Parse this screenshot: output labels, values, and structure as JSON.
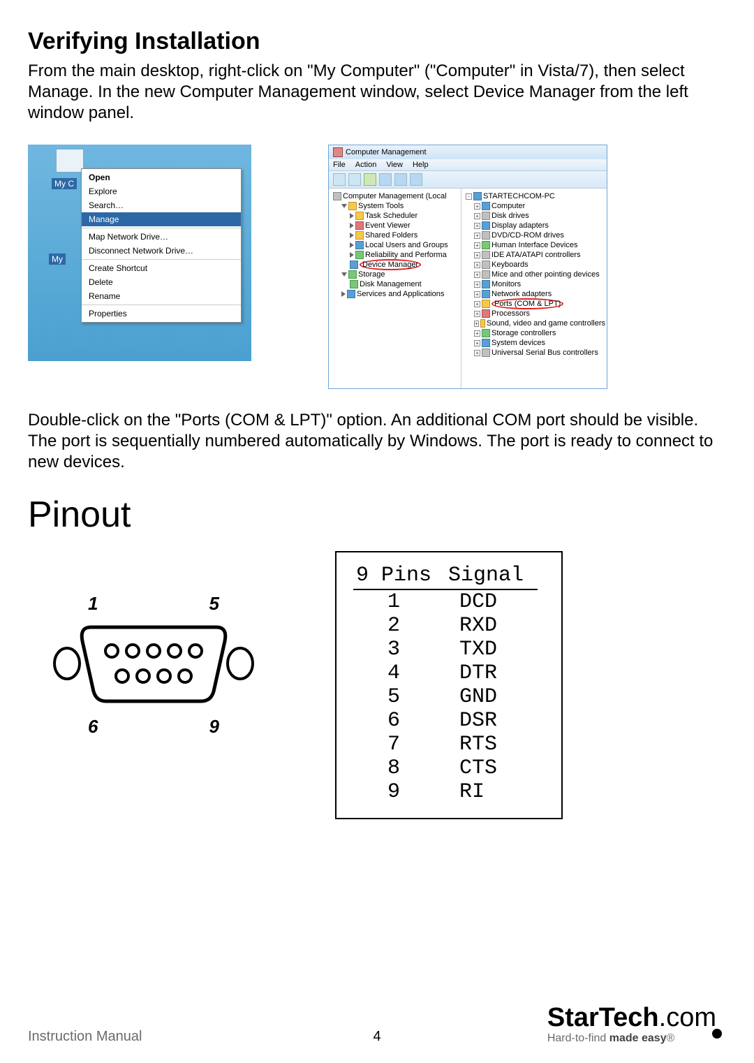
{
  "section1": {
    "title": "Verifying Installation",
    "para1": "From the main desktop, right-click on \"My Computer\" (\"Computer\" in Vista/7), then select Manage. In the new Computer Management window, select Device Manager from the left window panel.",
    "para2": "Double-click on the \"Ports (COM & LPT)\" option. An additional COM port should be visible. The port is sequentially numbered automatically by Windows.  The port is ready to connect to new devices."
  },
  "context_menu": {
    "desktop_icon_label_1": "My C",
    "desktop_icon_label_2": "My",
    "items": [
      [
        "Open",
        "Explore",
        "Search…",
        "Manage"
      ],
      [
        "Map Network Drive…",
        "Disconnect Network Drive…"
      ],
      [
        "Create Shortcut",
        "Delete",
        "Rename"
      ],
      [
        "Properties"
      ]
    ],
    "bold_index": 0,
    "selected": "Manage"
  },
  "cm_window": {
    "title": "Computer Management",
    "menubar": [
      "File",
      "Action",
      "View",
      "Help"
    ],
    "left_tree": [
      {
        "lvl": 0,
        "exp": "",
        "icon": "ico-gray",
        "label": "Computer Management (Local"
      },
      {
        "lvl": 1,
        "exp": "down",
        "icon": "ico-yellow",
        "label": "System Tools"
      },
      {
        "lvl": 2,
        "exp": "tri",
        "icon": "ico-yellow",
        "label": "Task Scheduler"
      },
      {
        "lvl": 2,
        "exp": "tri",
        "icon": "ico-red",
        "label": "Event Viewer"
      },
      {
        "lvl": 2,
        "exp": "tri",
        "icon": "ico-yellow",
        "label": "Shared Folders"
      },
      {
        "lvl": 2,
        "exp": "tri",
        "icon": "ico-blue",
        "label": "Local Users and Groups"
      },
      {
        "lvl": 2,
        "exp": "tri",
        "icon": "ico-green",
        "label": "Reliability and Performa"
      },
      {
        "lvl": 2,
        "exp": "",
        "icon": "ico-blue",
        "label": "Device Manager",
        "circled": true
      },
      {
        "lvl": 1,
        "exp": "down",
        "icon": "ico-green",
        "label": "Storage"
      },
      {
        "lvl": 2,
        "exp": "",
        "icon": "ico-green",
        "label": "Disk Management"
      },
      {
        "lvl": 1,
        "exp": "tri",
        "icon": "ico-blue",
        "label": "Services and Applications"
      }
    ],
    "right_tree": [
      {
        "lvl": 0,
        "exp": "-",
        "icon": "ico-blue",
        "label": "STARTECHCOM-PC"
      },
      {
        "lvl": 1,
        "exp": "+",
        "icon": "ico-blue",
        "label": "Computer"
      },
      {
        "lvl": 1,
        "exp": "+",
        "icon": "ico-gray",
        "label": "Disk drives"
      },
      {
        "lvl": 1,
        "exp": "+",
        "icon": "ico-blue",
        "label": "Display adapters"
      },
      {
        "lvl": 1,
        "exp": "+",
        "icon": "ico-gray",
        "label": "DVD/CD-ROM drives"
      },
      {
        "lvl": 1,
        "exp": "+",
        "icon": "ico-green",
        "label": "Human Interface Devices"
      },
      {
        "lvl": 1,
        "exp": "+",
        "icon": "ico-gray",
        "label": "IDE ATA/ATAPI controllers"
      },
      {
        "lvl": 1,
        "exp": "+",
        "icon": "ico-gray",
        "label": "Keyboards"
      },
      {
        "lvl": 1,
        "exp": "+",
        "icon": "ico-gray",
        "label": "Mice and other pointing devices"
      },
      {
        "lvl": 1,
        "exp": "+",
        "icon": "ico-blue",
        "label": "Monitors"
      },
      {
        "lvl": 1,
        "exp": "+",
        "icon": "ico-blue",
        "label": "Network adapters"
      },
      {
        "lvl": 1,
        "exp": "+",
        "icon": "ico-yellow",
        "label": "Ports (COM & LPT)",
        "circled": true
      },
      {
        "lvl": 1,
        "exp": "+",
        "icon": "ico-red",
        "label": "Processors"
      },
      {
        "lvl": 1,
        "exp": "+",
        "icon": "ico-yellow",
        "label": "Sound, video and game controllers"
      },
      {
        "lvl": 1,
        "exp": "+",
        "icon": "ico-green",
        "label": "Storage controllers"
      },
      {
        "lvl": 1,
        "exp": "+",
        "icon": "ico-blue",
        "label": "System devices"
      },
      {
        "lvl": 1,
        "exp": "+",
        "icon": "ico-gray",
        "label": "Universal Serial Bus controllers"
      }
    ]
  },
  "pinout": {
    "title": "Pinout",
    "corner_labels": {
      "tl": "1",
      "tr": "5",
      "bl": "6",
      "br": "9"
    },
    "table_header": {
      "col1": "9 Pins",
      "col2": "Signal"
    },
    "rows": [
      {
        "pin": "1",
        "sig": "DCD"
      },
      {
        "pin": "2",
        "sig": "RXD"
      },
      {
        "pin": "3",
        "sig": "TXD"
      },
      {
        "pin": "4",
        "sig": "DTR"
      },
      {
        "pin": "5",
        "sig": "GND"
      },
      {
        "pin": "6",
        "sig": "DSR"
      },
      {
        "pin": "7",
        "sig": "RTS"
      },
      {
        "pin": "8",
        "sig": "CTS"
      },
      {
        "pin": "9",
        "sig": "RI"
      }
    ]
  },
  "footer": {
    "left": "Instruction Manual",
    "page": "4",
    "logo_main": "StarTech",
    "logo_thin": ".com",
    "tagline_a": "Hard-to-find ",
    "tagline_b": "made easy",
    "tagline_c": "®"
  }
}
